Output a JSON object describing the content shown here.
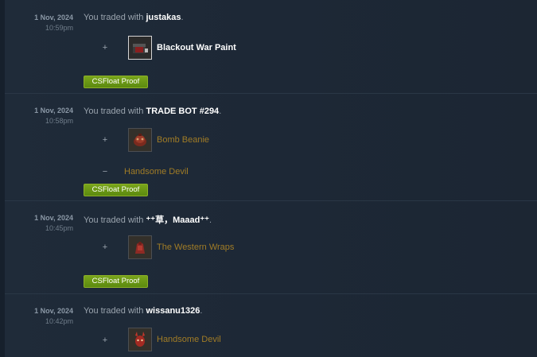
{
  "trades": [
    {
      "date": "1 Nov, 2024",
      "time": "10:59pm",
      "prefix": "You traded with ",
      "partner": "justakas",
      "suffix": ".",
      "items": [
        {
          "sign": "+",
          "name": "Blackout War Paint",
          "icon": "war-paint-icon",
          "style": "unique-white"
        }
      ],
      "proof_label": "CSFloat Proof"
    },
    {
      "date": "1 Nov, 2024",
      "time": "10:58pm",
      "prefix": "You traded with ",
      "partner": "TRADE BOT #294",
      "suffix": ".",
      "items": [
        {
          "sign": "+",
          "name": "Bomb Beanie",
          "icon": "bomb-beanie-icon",
          "style": "unique-gold"
        },
        {
          "sign": "−",
          "name": "Handsome Devil",
          "icon": "",
          "style": "unique-gold"
        }
      ],
      "proof_label": "CSFloat Proof"
    },
    {
      "date": "1 Nov, 2024",
      "time": "10:45pm",
      "prefix": "You traded with ",
      "partner": "⁺⁺草，Maaad⁺⁺",
      "suffix": ".",
      "items": [
        {
          "sign": "+",
          "name": "The Western Wraps",
          "icon": "western-wraps-icon",
          "style": "unique-gold"
        }
      ],
      "proof_label": "CSFloat Proof"
    },
    {
      "date": "1 Nov, 2024",
      "time": "10:42pm",
      "prefix": "You traded with ",
      "partner": "wissanu1326",
      "suffix": ".",
      "items": [
        {
          "sign": "+",
          "name": "Handsome Devil",
          "icon": "handsome-devil-icon",
          "style": "unique-gold"
        }
      ],
      "proof_label": ""
    }
  ],
  "colors": {
    "background": "#1b2838",
    "unique_item": "#a17c26",
    "partner_name": "#ffffff",
    "proof_button": "#6b9a17"
  }
}
